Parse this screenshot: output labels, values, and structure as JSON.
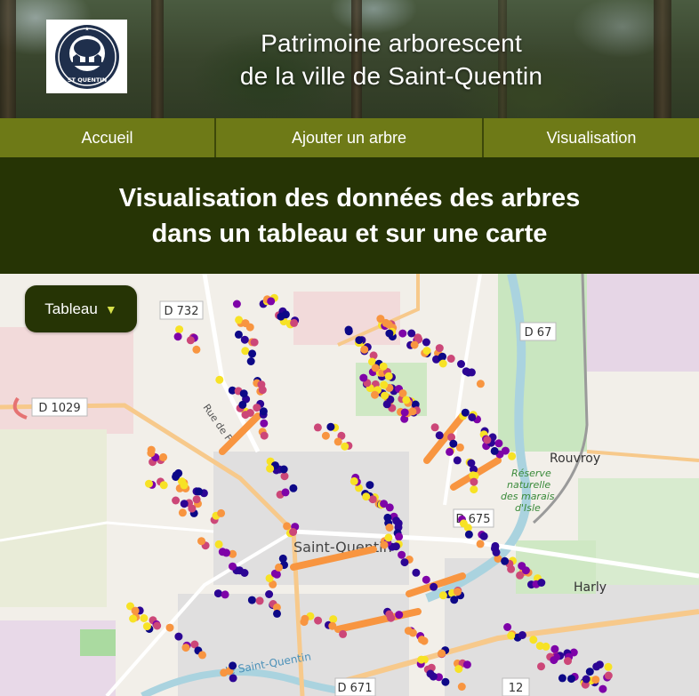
{
  "header": {
    "logo_icon": "town-seal-tree-icon",
    "logo_text": "ST QUENTIN",
    "title_line1": "Patrimoine arborescent",
    "title_line2": "de la ville de Saint-Quentin"
  },
  "nav": {
    "items": [
      {
        "label": "Accueil"
      },
      {
        "label": "Ajouter un arbre"
      },
      {
        "label": "Visualisation"
      }
    ]
  },
  "banner": {
    "line1": "Visualisation des données des arbres",
    "line2": "dans un tableau et sur une carte"
  },
  "view_select": {
    "value": "Tableau",
    "icon": "triangle-down-icon"
  },
  "map": {
    "labels": {
      "d732": "D 732",
      "d67": "D 67",
      "d1029": "D 1029",
      "rue": "Rue de F",
      "rouvroy": "Rouvroy",
      "reserve": [
        "Réserve",
        "naturelle",
        "des marais",
        "d'Isle"
      ],
      "d675": "D 675",
      "saint_quentin": "Saint-Quentin",
      "harly": "Harly",
      "d671": "D 671",
      "d12": "12",
      "canal": "de Saint-Quentin"
    },
    "marker_colors": [
      "#f7e225",
      "#f89540",
      "#cc4778",
      "#7e03a8",
      "#2c0594",
      "#0d0887"
    ]
  },
  "colors": {
    "nav_bg": "#6e7a17",
    "banner_bg": "#263405",
    "select_bg": "#263405"
  }
}
